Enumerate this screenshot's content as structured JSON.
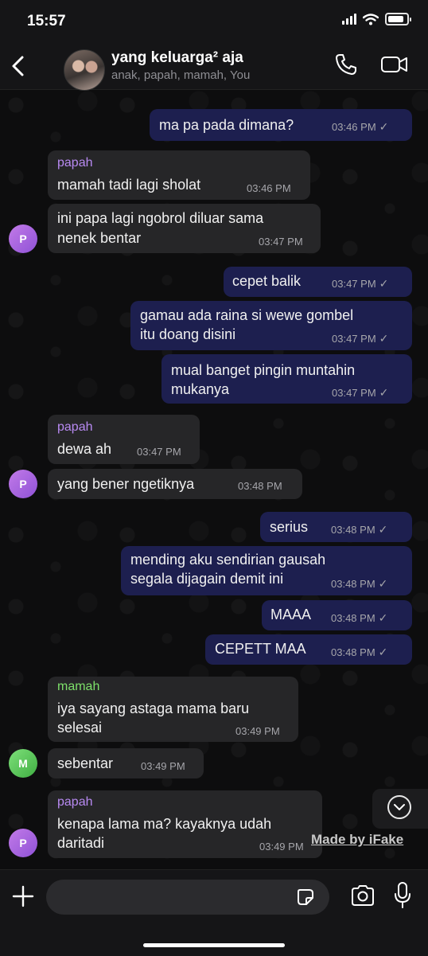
{
  "status_bar": {
    "time": "15:57"
  },
  "header": {
    "title": "yang keluarga² aja",
    "subtitle": "anak, papah, mamah, You"
  },
  "colors": {
    "papah": "#b88af2",
    "mamah": "#7de06a",
    "outgoing_bubble": "#1d1f4f",
    "incoming_bubble": "#262628"
  },
  "messages": [
    {
      "direction": "out",
      "text": [
        "ma pa pada dimana?"
      ],
      "time": "03:46 PM"
    },
    {
      "direction": "in",
      "sender": "papah",
      "text": [
        "mamah tadi lagi sholat"
      ],
      "time": "03:46 PM"
    },
    {
      "direction": "in",
      "avatar": "P",
      "text": [
        "ini papa lagi ngobrol diluar sama",
        "nenek bentar"
      ],
      "time": "03:47 PM"
    },
    {
      "direction": "out",
      "text": [
        "cepet balik"
      ],
      "time": "03:47 PM"
    },
    {
      "direction": "out",
      "text": [
        "gamau ada raina si wewe gombel",
        "itu doang disini"
      ],
      "time": "03:47 PM"
    },
    {
      "direction": "out",
      "text": [
        "mual banget pingin muntahin",
        "mukanya"
      ],
      "time": "03:47 PM"
    },
    {
      "direction": "in",
      "sender": "papah",
      "text": [
        "dewa ah"
      ],
      "time": "03:47 PM"
    },
    {
      "direction": "in",
      "avatar": "P",
      "text": [
        "yang bener ngetiknya"
      ],
      "time": "03:48 PM"
    },
    {
      "direction": "out",
      "text": [
        "serius"
      ],
      "time": "03:48 PM"
    },
    {
      "direction": "out",
      "text": [
        "mending aku sendirian gausah",
        "segala dijagain demit ini"
      ],
      "time": "03:48 PM"
    },
    {
      "direction": "out",
      "text": [
        "MAAA"
      ],
      "time": "03:48 PM"
    },
    {
      "direction": "out",
      "text": [
        "CEPETT MAA"
      ],
      "time": "03:48 PM"
    },
    {
      "direction": "in",
      "sender": "mamah",
      "text": [
        "iya sayang astaga mama baru",
        "selesai"
      ],
      "time": "03:49 PM"
    },
    {
      "direction": "in",
      "avatar": "M",
      "text": [
        "sebentar"
      ],
      "time": "03:49 PM"
    },
    {
      "direction": "in",
      "sender": "papah",
      "avatar": "P",
      "text": [
        "kenapa lama ma? kayaknya udah",
        "daritadi"
      ],
      "time": "03:49 PM"
    }
  ],
  "watermark": "Made by iFake",
  "composer": {
    "placeholder": ""
  }
}
